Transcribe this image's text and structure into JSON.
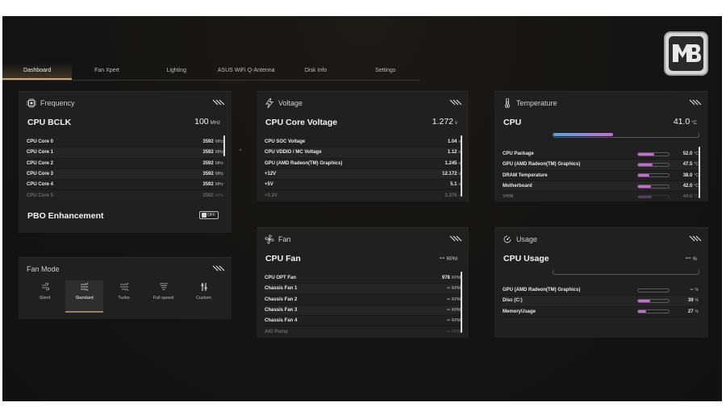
{
  "tabs": [
    "Dashboard",
    "Fan Xpert",
    "Lighting",
    "ASUS WiFi Q-Antenna",
    "Disk Info",
    "Settings"
  ],
  "frequency": {
    "title": "Frequency",
    "main_label": "CPU BCLK",
    "main_value": "100",
    "main_unit": "MHz",
    "rows": [
      {
        "label": "CPU Core 0",
        "value": "3592",
        "unit": "MHz"
      },
      {
        "label": "CPU Core 1",
        "value": "3592",
        "unit": "MHz"
      },
      {
        "label": "CPU Core 2",
        "value": "3592",
        "unit": "MHz"
      },
      {
        "label": "CPU Core 3",
        "value": "3592",
        "unit": "MHz"
      },
      {
        "label": "CPU Core 4",
        "value": "3592",
        "unit": "MHz"
      },
      {
        "label": "CPU Core 5",
        "value": "3592",
        "unit": "MHz"
      }
    ],
    "pbo_label": "PBO Enhancement",
    "pbo_state": "OFF"
  },
  "fan_mode": {
    "title": "Fan Mode",
    "modes": [
      "Silent",
      "Standard",
      "Turbo",
      "Full speed",
      "Custom"
    ],
    "selected": "Standard"
  },
  "voltage": {
    "title": "Voltage",
    "main_label": "CPU Core Voltage",
    "main_value": "1.272",
    "main_unit": "v",
    "rows": [
      {
        "label": "CPU SOC Voltage",
        "value": "1.04",
        "unit": "v"
      },
      {
        "label": "CPU VDDIO / MC Voltage",
        "value": "1.12",
        "unit": "v"
      },
      {
        "label": "GPU (AMD Radeon(TM) Graphics)",
        "value": "1.245",
        "unit": "v"
      },
      {
        "label": "+12V",
        "value": "12.172",
        "unit": "v"
      },
      {
        "label": "+5V",
        "value": "5.1",
        "unit": "v"
      },
      {
        "label": "+3.3V",
        "value": "3.376",
        "unit": "v"
      }
    ]
  },
  "fan": {
    "title": "Fan",
    "main_label": "CPU Fan",
    "main_value": "--",
    "main_unit": "RPM",
    "rows": [
      {
        "label": "CPU OPT Fan",
        "value": "978",
        "unit": "RPM"
      },
      {
        "label": "Chassis Fan 1",
        "value": "--",
        "unit": "RPM"
      },
      {
        "label": "Chassis Fan 2",
        "value": "--",
        "unit": "RPM"
      },
      {
        "label": "Chassis Fan 3",
        "value": "--",
        "unit": "RPM"
      },
      {
        "label": "Chassis Fan 4",
        "value": "--",
        "unit": "RPM"
      },
      {
        "label": "AIO Pump",
        "value": "--",
        "unit": "RPM"
      }
    ]
  },
  "temperature": {
    "title": "Temperature",
    "main_label": "CPU",
    "main_value": "41.0",
    "main_unit": "°C",
    "main_fill": 0.41,
    "rows": [
      {
        "label": "CPU Package",
        "value": "52.0",
        "unit": "°C",
        "fill": 0.52
      },
      {
        "label": "GPU (AMD Radeon(TM) Graphics)",
        "value": "47.5",
        "unit": "°C",
        "fill": 0.475
      },
      {
        "label": "DRAM Temperature",
        "value": "38.0",
        "unit": "°C",
        "fill": 0.38
      },
      {
        "label": "Motherboard",
        "value": "42.0",
        "unit": "°C",
        "fill": 0.42
      },
      {
        "label": "VRM",
        "value": "44.0",
        "unit": "°C",
        "fill": 0.44
      }
    ]
  },
  "usage": {
    "title": "Usage",
    "main_label": "CPU Usage",
    "main_value": "--",
    "main_unit": "%",
    "rows": [
      {
        "label": "GPU (AMD Radeon(TM) Graphics)",
        "value": "--",
        "unit": "%",
        "fill": 0
      },
      {
        "label": "Disc (C:)",
        "value": "39",
        "unit": "%",
        "fill": 0.39
      },
      {
        "label": "MemoryUsage",
        "value": "27",
        "unit": "%",
        "fill": 0.27
      }
    ]
  },
  "colors": {
    "accent": "#c86ad8",
    "tab_active": "#c9a77a",
    "temp_gradient": [
      "#4aa8e0",
      "#c86ad8"
    ]
  }
}
